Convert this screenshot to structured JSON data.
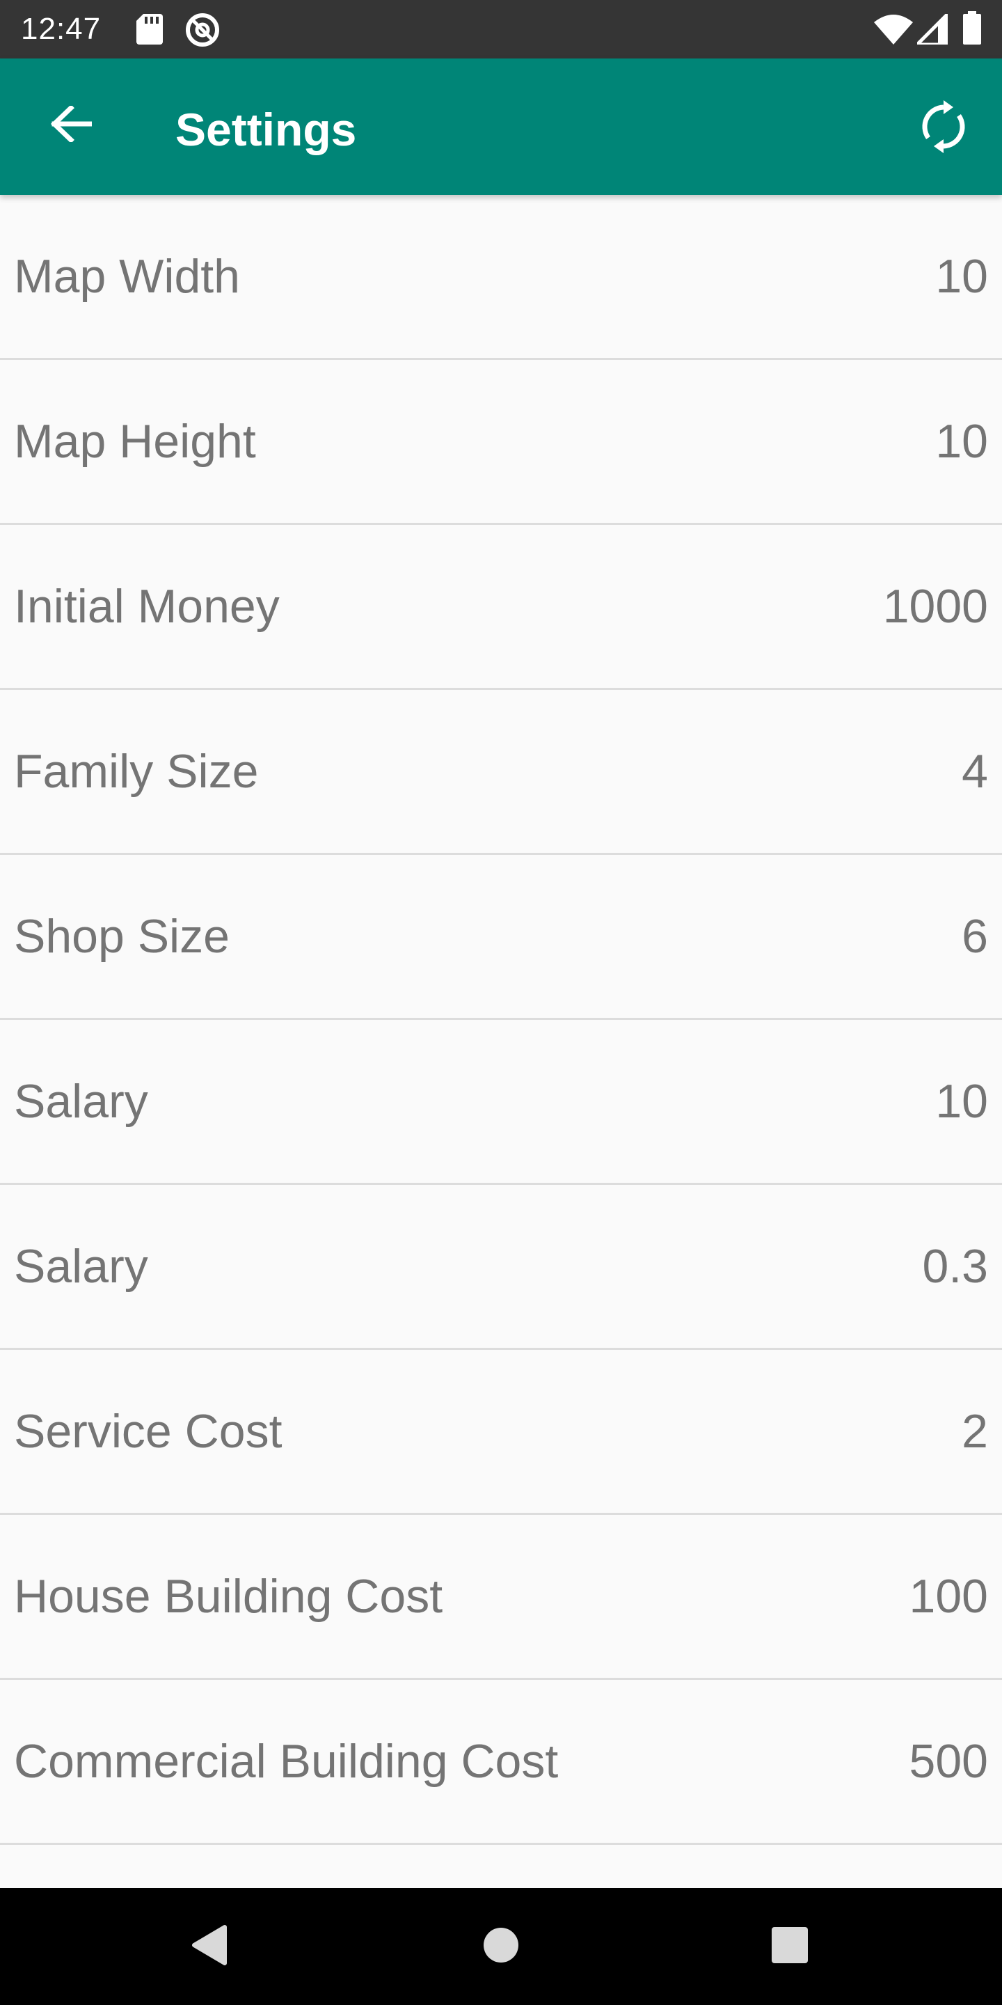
{
  "status_bar": {
    "time": "12:47",
    "left_icons": [
      "sd-card-icon",
      "at-sign-icon"
    ],
    "right_icons": [
      "wifi-icon",
      "cell-signal-icon",
      "battery-icon"
    ]
  },
  "app_bar": {
    "title": "Settings",
    "back_icon": "arrow-left-icon",
    "action_icon": "sync-icon",
    "color": "#008577"
  },
  "settings": [
    {
      "label": "Map Width",
      "value": "10"
    },
    {
      "label": "Map Height",
      "value": "10"
    },
    {
      "label": "Initial Money",
      "value": "1000"
    },
    {
      "label": "Family Size",
      "value": "4"
    },
    {
      "label": "Shop Size",
      "value": "6"
    },
    {
      "label": "Salary",
      "value": "10"
    },
    {
      "label": "Salary",
      "value": "0.3"
    },
    {
      "label": "Service Cost",
      "value": "2"
    },
    {
      "label": "House Building Cost",
      "value": "100"
    },
    {
      "label": "Commercial Building Cost",
      "value": "500"
    },
    {
      "label": "",
      "value": ""
    }
  ],
  "nav_bar": {
    "buttons": [
      "back-triangle-icon",
      "home-circle-icon",
      "recents-square-icon"
    ]
  }
}
